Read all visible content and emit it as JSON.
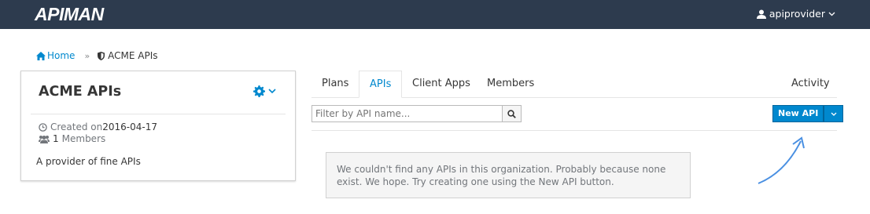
{
  "header": {
    "logo": "APIMAN",
    "user": "apiprovider"
  },
  "breadcrumb": {
    "home": "Home",
    "separator": "»",
    "current": "ACME APIs"
  },
  "org_card": {
    "title": "ACME APIs",
    "created_label": "Created on",
    "created_date": "2016-04-17",
    "member_count": "1",
    "members_label": "Members",
    "description": "A provider of fine APIs"
  },
  "tabs": [
    {
      "label": "Plans",
      "active": false
    },
    {
      "label": "APIs",
      "active": true
    },
    {
      "label": "Client Apps",
      "active": false
    },
    {
      "label": "Members",
      "active": false
    },
    {
      "label": "Activity",
      "active": false
    }
  ],
  "filter": {
    "placeholder": "Filter by API name..."
  },
  "new_api_button": {
    "label": "New API"
  },
  "empty_message": "We couldn't find any APIs in this organization. Probably because none exist. We hope. Try creating one using the New API button.",
  "colors": {
    "topbar": "#2d3b4e",
    "accent": "#0088ce",
    "arrow": "#4a90e2"
  },
  "icons": [
    "user-icon",
    "chevron-down-icon",
    "home-icon",
    "shield-icon",
    "gear-icon",
    "clock-icon",
    "users-icon",
    "search-icon",
    "arrow-icon"
  ]
}
